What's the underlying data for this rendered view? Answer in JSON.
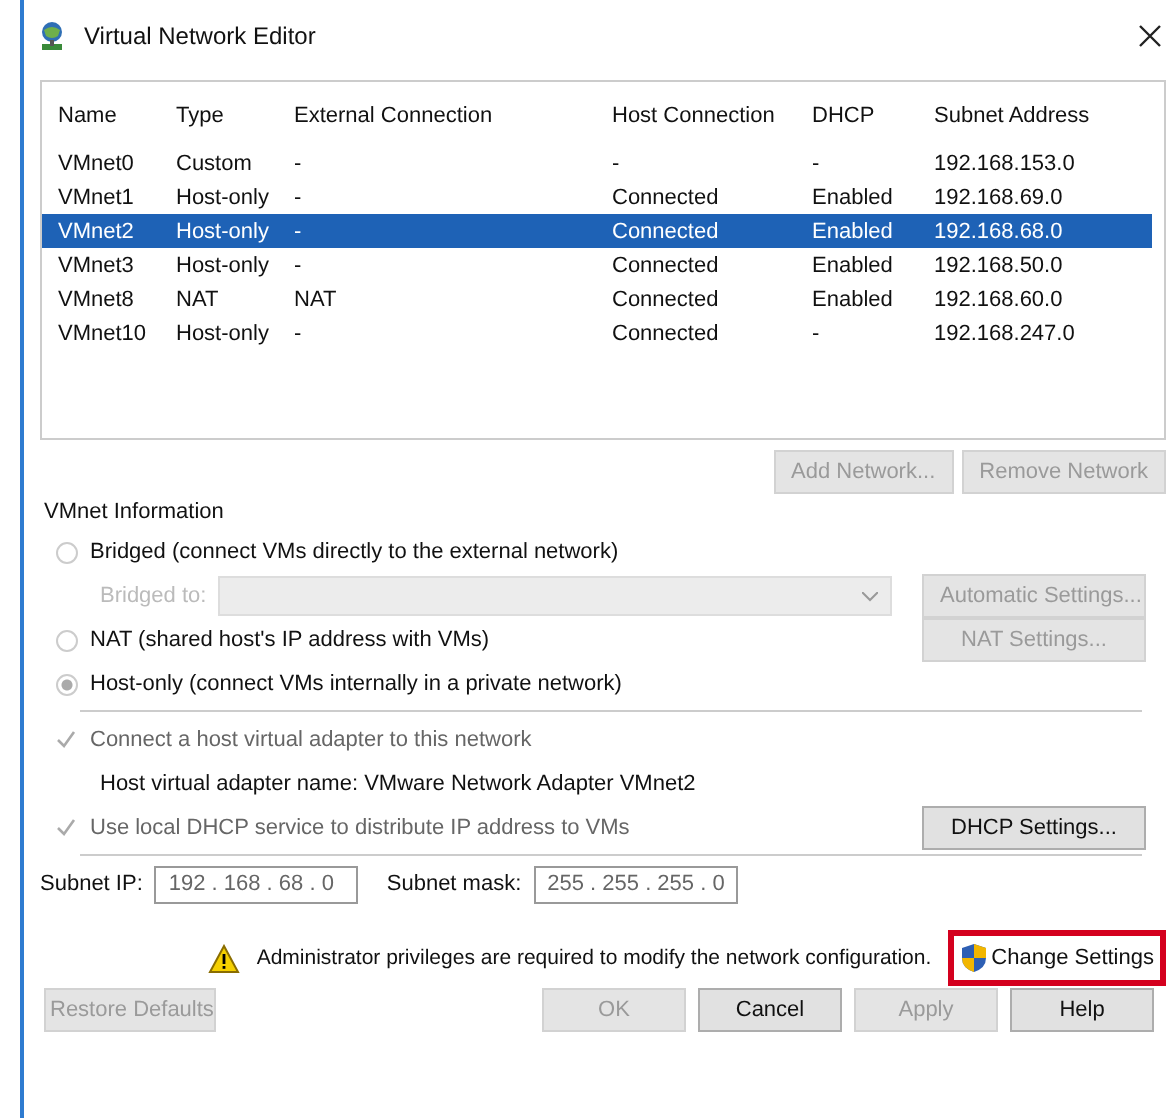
{
  "window": {
    "title": "Virtual Network Editor"
  },
  "table": {
    "columns": [
      "Name",
      "Type",
      "External Connection",
      "Host Connection",
      "DHCP",
      "Subnet Address"
    ],
    "rows": [
      {
        "cells": [
          "VMnet0",
          "Custom",
          "-",
          "-",
          "-",
          "192.168.153.0"
        ],
        "selected": false
      },
      {
        "cells": [
          "VMnet1",
          "Host-only",
          "-",
          "Connected",
          "Enabled",
          "192.168.69.0"
        ],
        "selected": false
      },
      {
        "cells": [
          "VMnet2",
          "Host-only",
          "-",
          "Connected",
          "Enabled",
          "192.168.68.0"
        ],
        "selected": true
      },
      {
        "cells": [
          "VMnet3",
          "Host-only",
          "-",
          "Connected",
          "Enabled",
          "192.168.50.0"
        ],
        "selected": false
      },
      {
        "cells": [
          "VMnet8",
          "NAT",
          "NAT",
          "Connected",
          "Enabled",
          "192.168.60.0"
        ],
        "selected": false
      },
      {
        "cells": [
          "VMnet10",
          "Host-only",
          "-",
          "Connected",
          "-",
          "192.168.247.0"
        ],
        "selected": false
      }
    ]
  },
  "table_buttons": [
    {
      "label": "Add Network...",
      "disabled": true
    },
    {
      "label": "Remove Network",
      "disabled": true
    }
  ],
  "vmnet_information": {
    "title": "VMnet Information",
    "sections": [
      [
        {
          "kind": "radio",
          "label": "Bridged (connect VMs directly to the external network)",
          "selected": false
        },
        {
          "kind": "combo",
          "label": "Bridged to:",
          "disabled": true,
          "button": {
            "label": "Automatic Settings...",
            "disabled": true
          }
        },
        {
          "kind": "radio",
          "label": "NAT (shared host's IP address with VMs)",
          "selected": false,
          "button": {
            "label": "NAT Settings...",
            "disabled": true
          }
        },
        {
          "kind": "radio",
          "label": "Host-only (connect VMs internally in a private network)",
          "selected": true
        }
      ],
      [
        {
          "kind": "checkbox",
          "label": "Connect a host virtual adapter to this network",
          "checked": true,
          "disabled": true
        },
        {
          "kind": "text",
          "label": "Host virtual adapter name: VMware Network Adapter VMnet2"
        },
        {
          "kind": "checkbox",
          "label": "Use local DHCP service to distribute IP address to VMs",
          "checked": true,
          "disabled": true,
          "button": {
            "label": "DHCP Settings...",
            "disabled": false
          }
        }
      ],
      [
        {
          "kind": "fields",
          "fields": [
            {
              "label": "Subnet IP:",
              "value": "192 . 168 . 68 . 0"
            },
            {
              "label": "Subnet mask:",
              "value": "255 . 255 . 255 . 0"
            }
          ]
        }
      ]
    ]
  },
  "notice": {
    "text": "Administrator privileges are required to modify the network configuration.",
    "button": {
      "label": "Change Settings",
      "highlighted": true
    }
  },
  "footer_buttons": [
    {
      "label": "Restore Defaults",
      "disabled": true
    },
    {
      "label": "OK",
      "disabled": true
    },
    {
      "label": "Cancel",
      "disabled": false
    },
    {
      "label": "Apply",
      "disabled": true
    },
    {
      "label": "Help",
      "disabled": false
    }
  ]
}
